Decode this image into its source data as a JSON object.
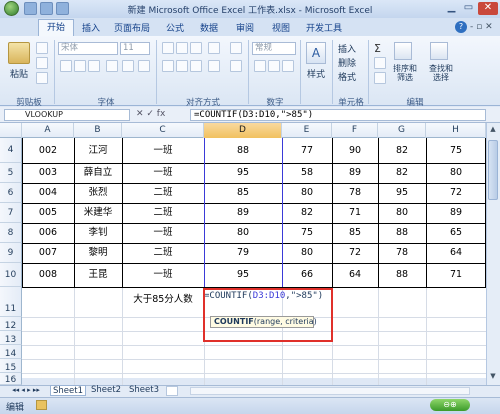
{
  "window": {
    "title": "新建 Microsoft Office Excel 工作表.xlsx - Microsoft Excel"
  },
  "ribbon_tabs": [
    "开始",
    "插入",
    "页面布局",
    "公式",
    "数据",
    "审阅",
    "视图",
    "开发工具"
  ],
  "ribbon": {
    "paste_label": "粘贴",
    "font_name": "宋体",
    "font_size": "11",
    "number_format": "常规",
    "styles_label": "样式",
    "insert_label": "插入",
    "delete_label": "删除",
    "format_label": "格式",
    "sort_label": "排序和\n筛选",
    "find_label": "查找和\n选择",
    "groups": [
      "剪贴板",
      "字体",
      "对齐方式",
      "数字",
      "单元格",
      "编辑"
    ]
  },
  "formula_bar": {
    "name_box": "VLOOKUP",
    "fx_symbols": "✕ ✓ fx",
    "formula": "=COUNTIF(D3:D10,\">85\")"
  },
  "columns": [
    "A",
    "B",
    "C",
    "D",
    "E",
    "F",
    "G",
    "H"
  ],
  "row_numbers": [
    "4",
    "5",
    "6",
    "7",
    "8",
    "9",
    "10",
    "11",
    "12",
    "13",
    "14",
    "15",
    "16"
  ],
  "rows": [
    [
      "002",
      "江河",
      "一班",
      "88",
      "77",
      "90",
      "82",
      "75"
    ],
    [
      "003",
      "薛自立",
      "一班",
      "95",
      "58",
      "89",
      "82",
      "80"
    ],
    [
      "004",
      "张烈",
      "二班",
      "85",
      "80",
      "78",
      "95",
      "72"
    ],
    [
      "005",
      "米建华",
      "二班",
      "89",
      "82",
      "71",
      "80",
      "89"
    ],
    [
      "006",
      "李钊",
      "一班",
      "80",
      "75",
      "85",
      "88",
      "65"
    ],
    [
      "007",
      "黎明",
      "二班",
      "79",
      "80",
      "72",
      "78",
      "64"
    ],
    [
      "008",
      "王昆",
      "一班",
      "95",
      "66",
      "64",
      "88",
      "71"
    ]
  ],
  "row11": {
    "label": "大于85分人数",
    "formula_text": "=COUNTIF(D3:D10,\">85\")",
    "formula_prefix": "=COUNTIF(",
    "formula_ref": "D3:D10",
    "formula_suffix": ",\">85\")"
  },
  "tooltip": {
    "func": "COUNTIF",
    "args": "(range, criteria)"
  },
  "sheets": [
    "Sheet1",
    "Sheet2",
    "Sheet3"
  ],
  "status": {
    "mode": "编辑"
  },
  "colors": {
    "highlight_box": "#e0302a",
    "range_ref": "#3a3ad8",
    "selected_col_header": "#f1c15f"
  }
}
